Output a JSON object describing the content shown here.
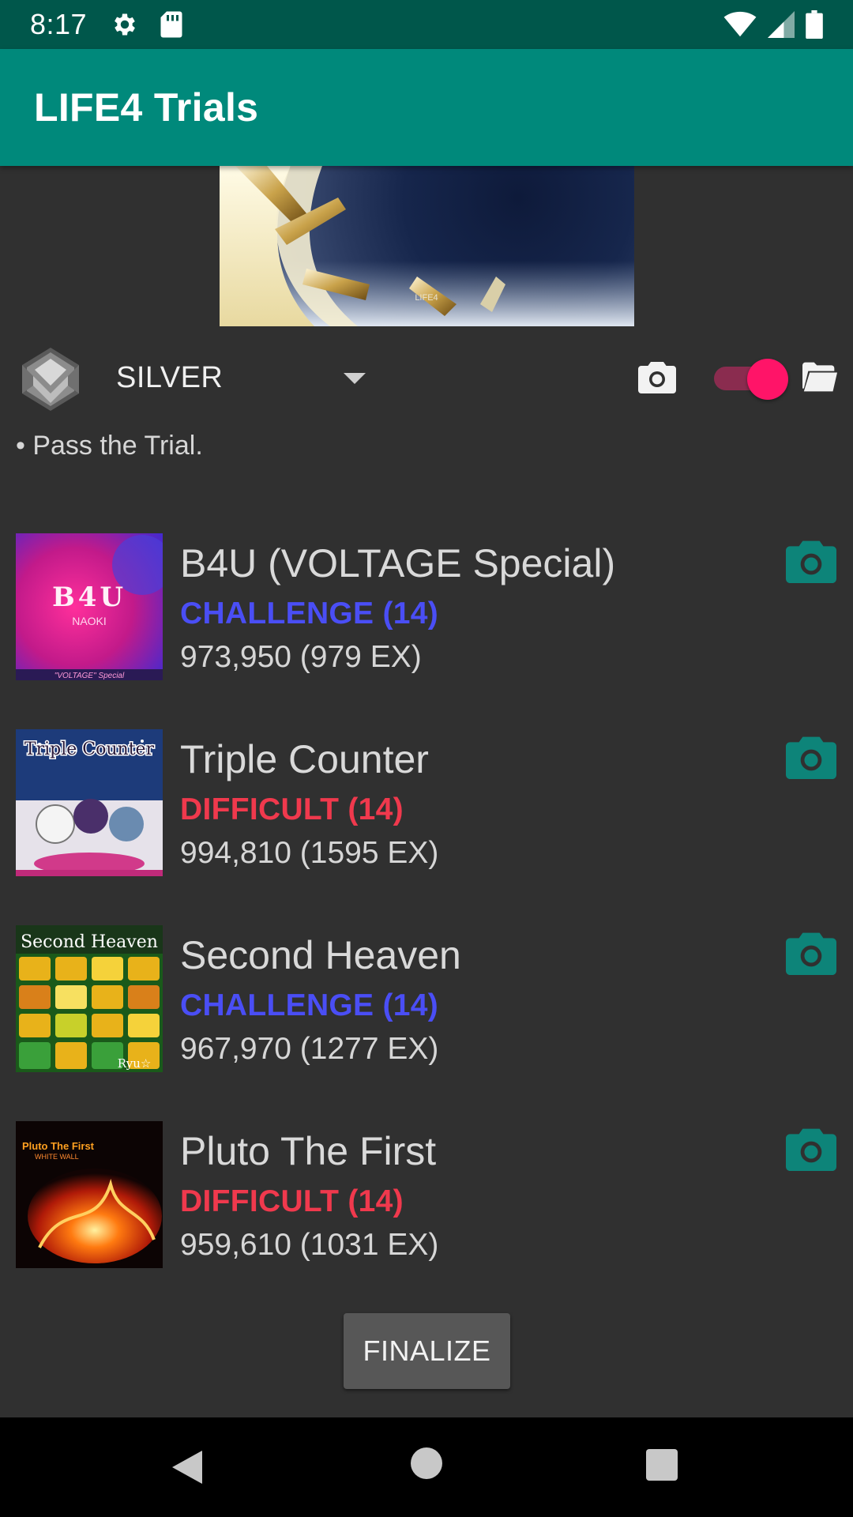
{
  "status_bar": {
    "time": "8:17"
  },
  "app_bar": {
    "title": "LIFE4 Trials"
  },
  "trial": {
    "rank": "SILVER",
    "goal": "• Pass the Trial.",
    "toggle_on": true
  },
  "songs": [
    {
      "title": "B4U (VOLTAGE Special)",
      "difficulty": "CHALLENGE (14)",
      "difficulty_color": "#4a4ef5",
      "score": "973,950 (979 EX)",
      "jacket_text": "B4U",
      "jacket_sub": "NAOKI",
      "jacket_caption": "\"VOLTAGE\" Special"
    },
    {
      "title": "Triple Counter",
      "difficulty": "DIFFICULT (14)",
      "difficulty_color": "#f0394d",
      "score": "994,810 (1595 EX)",
      "jacket_text": "Triple Counter"
    },
    {
      "title": "Second Heaven",
      "difficulty": "CHALLENGE (14)",
      "difficulty_color": "#4a4ef5",
      "score": "967,970 (1277 EX)",
      "jacket_text": "Second Heaven",
      "jacket_sub": "Ryu☆"
    },
    {
      "title": "Pluto The First",
      "difficulty": "DIFFICULT (14)",
      "difficulty_color": "#f0394d",
      "score": "959,610 (1031 EX)",
      "jacket_text": "Pluto The First",
      "jacket_sub": "WHITE WALL"
    }
  ],
  "finalize_label": "FINALIZE",
  "banner_caption": "LIFE4",
  "colors": {
    "accent_teal": "#00897b",
    "status_teal": "#00574b",
    "camera_teal": "#0d8479",
    "toggle_pink": "#ff1468"
  }
}
